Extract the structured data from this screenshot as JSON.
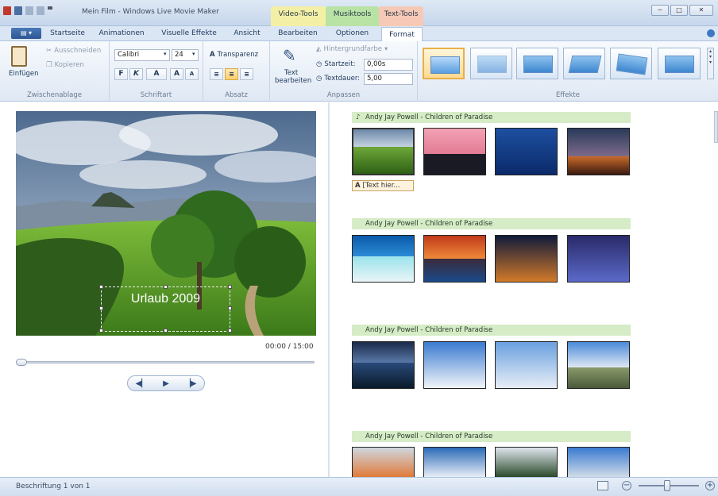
{
  "window": {
    "title": "Mein Film - Windows Live Movie Maker",
    "context_tabs": [
      {
        "label": "Video-Tools",
        "color": "#f3f0a6"
      },
      {
        "label": "Musiktools",
        "color": "#b9e3a5"
      },
      {
        "label": "Text-Tools",
        "color": "#f5c9b5"
      }
    ]
  },
  "tabs": {
    "file_icon": "file-menu-icon",
    "items": [
      "Startseite",
      "Animationen",
      "Visuelle Effekte",
      "Ansicht",
      "Bearbeiten",
      "Optionen",
      "Format"
    ],
    "active": "Format"
  },
  "ribbon": {
    "clipboard": {
      "paste": "Einfügen",
      "cut": "Ausschneiden",
      "copy": "Kopieren",
      "group": "Zwischenablage"
    },
    "font": {
      "family": "Calibri",
      "size": "24",
      "bold": "F",
      "italic": "K",
      "color": "A",
      "grow": "A",
      "shrink": "A",
      "group": "Schriftart"
    },
    "paragraph": {
      "transparency": "Transparenz",
      "group": "Absatz"
    },
    "adjust": {
      "edit_text_line1": "Text",
      "edit_text_line2": "bearbeiten",
      "background_color": "Hintergrundfarbe",
      "start_label": "Startzeit:",
      "start_value": "0,00s",
      "duration_label": "Textdauer:",
      "duration_value": "5,00",
      "group": "Anpassen"
    },
    "effects": {
      "group": "Effekte"
    }
  },
  "preview": {
    "caption": "Urlaub 2009",
    "timecode": "00:00 / 15:00"
  },
  "storyboard": {
    "text_chip": "[Text hier...",
    "music_label": "Andy Jay Powell - Children of Paradise"
  },
  "status": {
    "text": "Beschriftung 1 von 1",
    "zoom_level": 0.45
  },
  "colors": {
    "accent": "#e7b04a",
    "music_bar": "#d5ecc6"
  }
}
